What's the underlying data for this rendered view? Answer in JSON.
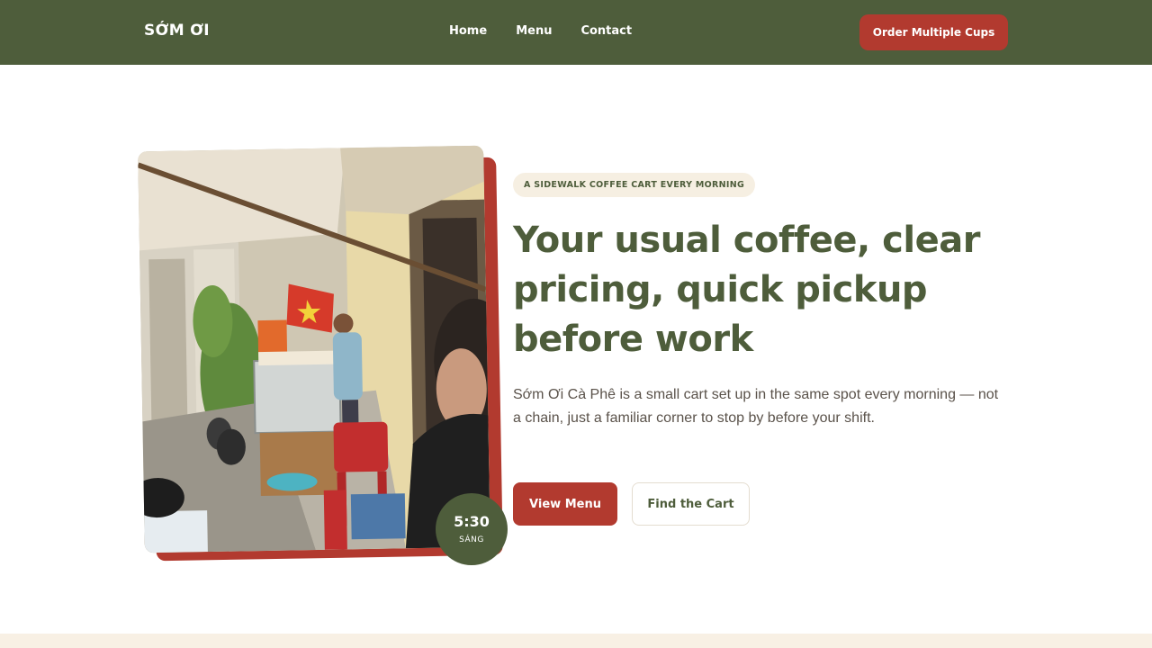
{
  "nav": {
    "brand": "SỚM ƠI",
    "links": [
      "Home",
      "Menu",
      "Contact"
    ],
    "cta": "Order Multiple Cups"
  },
  "hero": {
    "eyebrow": "A SIDEWALK COFFEE CART EVERY MORNING",
    "headline": "Your usual coffee, clear pricing, quick pickup before work",
    "lede": "Sớm Ơi Cà Phê is a small cart set up in the same spot every morning — not a chain, just a familiar corner to stop by before your shift.",
    "primary_button": "View Menu",
    "secondary_button": "Find the Cart",
    "badge_time": "5:30",
    "badge_label": "SÁNG"
  },
  "colors": {
    "olive": "#4e5d3b",
    "red": "#b23a2f",
    "cream": "#f6efe2"
  }
}
